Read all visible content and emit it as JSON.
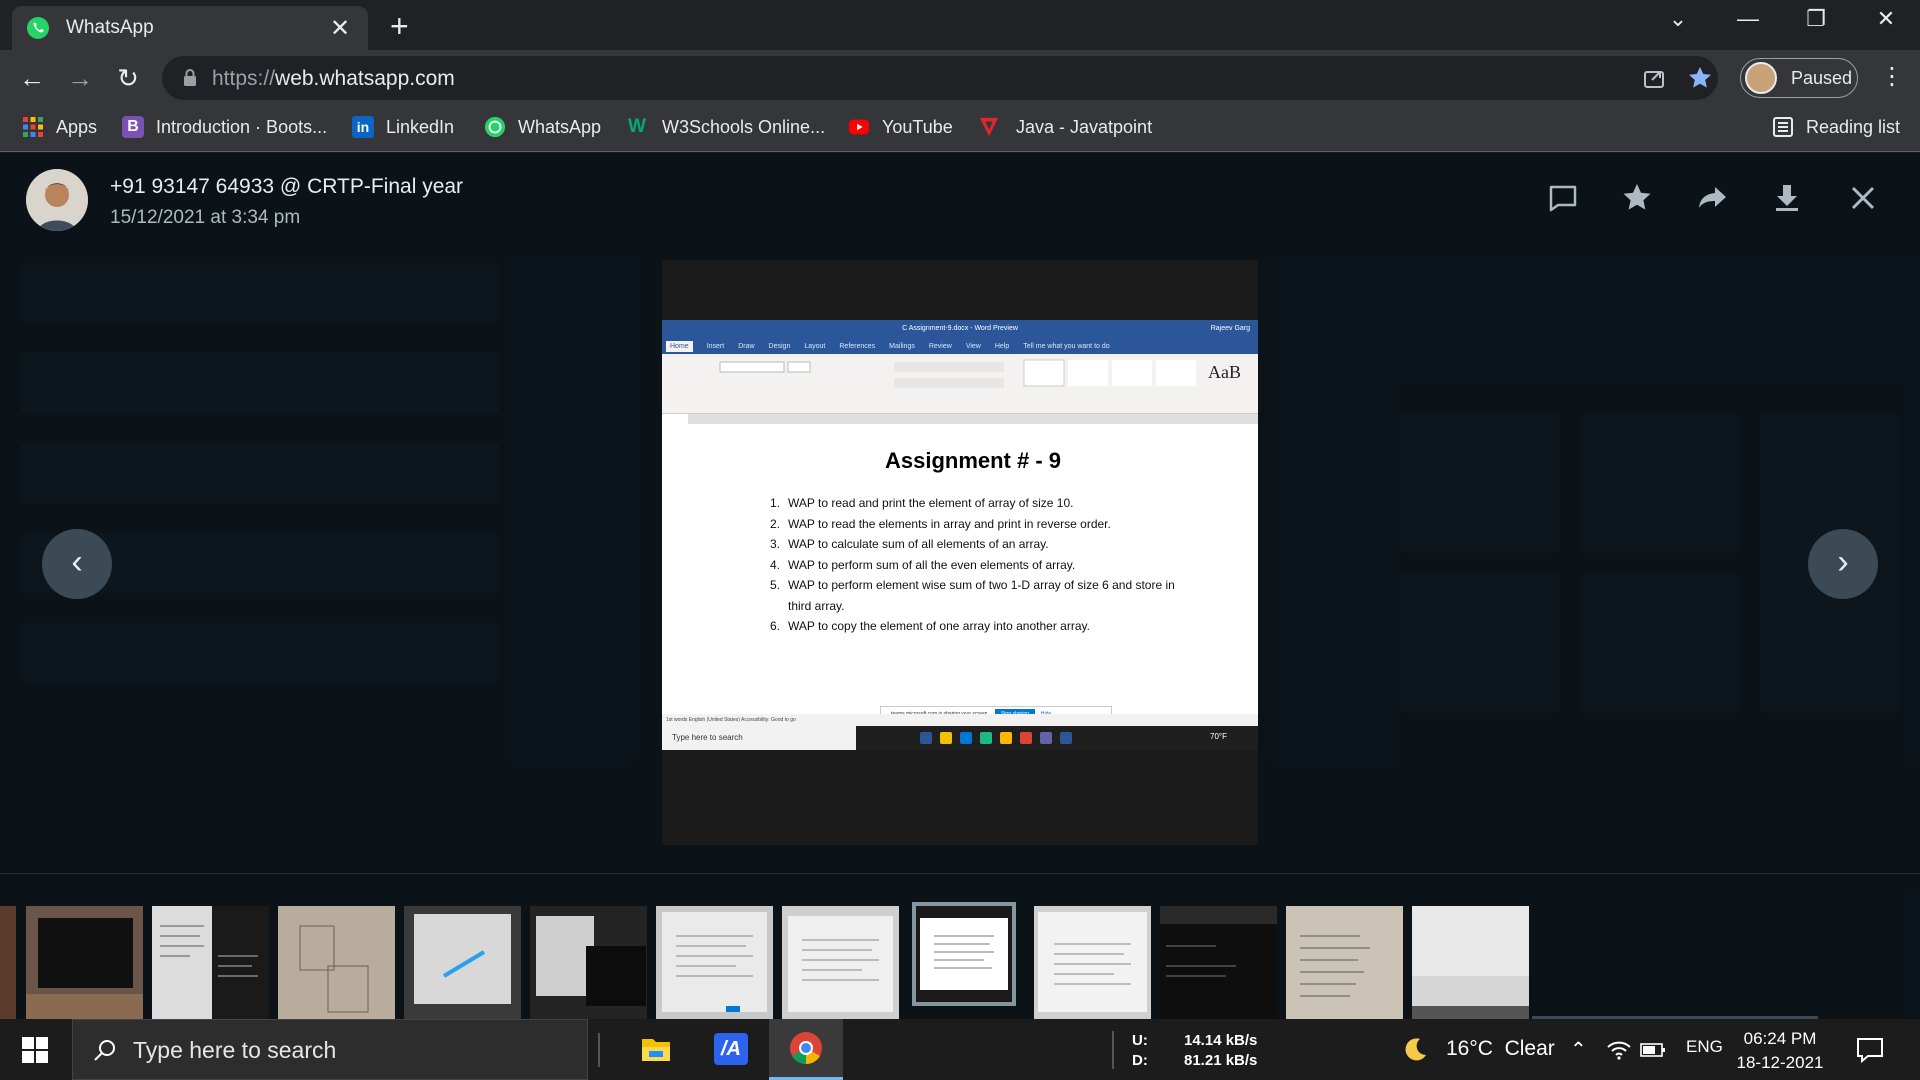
{
  "browser": {
    "tab_title": "WhatsApp",
    "tab_close": "✕",
    "new_tab": "+",
    "url_scheme": "https://",
    "url_host": "web.whatsapp.com",
    "profile_label": "Paused",
    "bookmarks": [
      {
        "label": "Apps",
        "icon": "apps-grid-icon"
      },
      {
        "label": "Introduction · Boots...",
        "icon": "bootstrap-icon",
        "color": "#7952b3"
      },
      {
        "label": "LinkedIn",
        "icon": "linkedin-icon",
        "color": "#0a66c2"
      },
      {
        "label": "WhatsApp",
        "icon": "whatsapp-icon",
        "color": "#25d366"
      },
      {
        "label": "W3Schools Online...",
        "icon": "w3schools-icon",
        "color": "#04aa6d"
      },
      {
        "label": "YouTube",
        "icon": "youtube-icon",
        "color": "#ff0000"
      },
      {
        "label": "Java - Javatpoint",
        "icon": "javatpoint-icon",
        "color": "#e0252f"
      }
    ],
    "reading_list": "Reading list"
  },
  "viewer": {
    "sender": "+91 93147 64933 @ CRTP-Final year",
    "timestamp": "15/12/2021 at 3:34 pm",
    "actions": [
      "reply-icon",
      "star-icon",
      "forward-icon",
      "download-icon",
      "close-icon"
    ],
    "prev_label": "‹",
    "next_label": "›"
  },
  "media": {
    "word_window_title": "C Assignment-9.docx - Word Preview",
    "word_user": "Rajeev Garg",
    "word_tabs": [
      "Home",
      "Insert",
      "Draw",
      "Design",
      "Layout",
      "References",
      "Mailings",
      "Review",
      "View",
      "Help",
      "Tell me what you want to do"
    ],
    "doc_title": "Assignment # - 9",
    "items": [
      {
        "num": "1.",
        "text": "WAP to read and print the element of array of size 10."
      },
      {
        "num": "2.",
        "text": "WAP to read the elements in array and print in reverse order."
      },
      {
        "num": "3.",
        "text": "WAP to calculate sum of all elements of an array."
      },
      {
        "num": "4.",
        "text": "WAP to perform sum of all the even elements of array."
      },
      {
        "num": "5.",
        "text": "WAP to perform element wise sum of two 1-D array of size 6 and store in"
      },
      {
        "num": "",
        "text": "third array."
      },
      {
        "num": "6.",
        "text": "WAP to copy the element of one array into another array."
      }
    ],
    "share_text": "teams.microsoft.com is sharing your screen.",
    "share_stop": "Stop sharing",
    "share_hide": "Hide",
    "status_text": "1st words   English (United States)   Accessibility: Good to go",
    "inner_search": "Type here to search",
    "inner_temp": "70°F"
  },
  "thumbnails": {
    "count_visible": 12,
    "selected_index": 7
  },
  "taskbar": {
    "search_placeholder": "Type here to search",
    "net_up_label": "U:",
    "net_up": "14.14 kB/s",
    "net_down_label": "D:",
    "net_down": "81.21 kB/s",
    "weather": "16°C  Clear",
    "lang": "ENG",
    "time": "06:24 PM",
    "date": "18-12-2021"
  }
}
